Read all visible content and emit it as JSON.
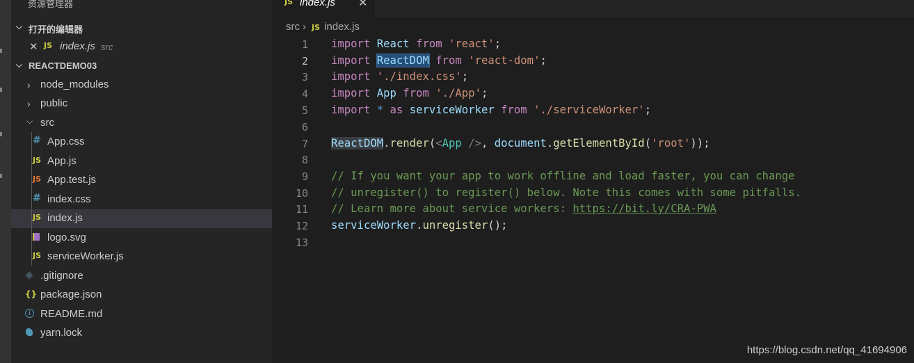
{
  "sidebar": {
    "title": "资源管理器",
    "open_editors": {
      "label": "打开的编辑器",
      "item": {
        "name": "index.js",
        "desc": "src"
      }
    },
    "project": {
      "label": "REACTDEMO03"
    },
    "tree": [
      {
        "name": "node_modules",
        "kind": "folder",
        "icon": ""
      },
      {
        "name": "public",
        "kind": "folder",
        "icon": ""
      },
      {
        "name": "src",
        "kind": "folder-open",
        "icon": ""
      },
      {
        "name": "App.css",
        "kind": "file",
        "icon": "#"
      },
      {
        "name": "App.js",
        "kind": "file",
        "icon": "JS"
      },
      {
        "name": "App.test.js",
        "kind": "file",
        "icon": "JS"
      },
      {
        "name": "index.css",
        "kind": "file",
        "icon": "#"
      },
      {
        "name": "index.js",
        "kind": "file",
        "icon": "JS"
      },
      {
        "name": "logo.svg",
        "kind": "file",
        "icon": "svg-icon"
      },
      {
        "name": "serviceWorker.js",
        "kind": "file",
        "icon": "JS"
      },
      {
        "name": ".gitignore",
        "kind": "file",
        "icon": "git-icon"
      },
      {
        "name": "package.json",
        "kind": "file",
        "icon": "{}"
      },
      {
        "name": "README.md",
        "kind": "file",
        "icon": "info-icon"
      },
      {
        "name": "yarn.lock",
        "kind": "file",
        "icon": "yarn-icon"
      }
    ]
  },
  "tab": {
    "name": "index.js",
    "icon": "JS"
  },
  "breadcrumb": {
    "folder": "src",
    "file": "index.js",
    "icon": "JS"
  },
  "editor": {
    "line_numbers": [
      "1",
      "2",
      "3",
      "4",
      "5",
      "6",
      "7",
      "8",
      "9",
      "10",
      "11",
      "12",
      "13"
    ],
    "active_line": "2",
    "tokens": {
      "import": "import",
      "from": "from",
      "as": "as",
      "React": "React",
      "ReactDOM": "ReactDOM",
      "App": "App",
      "star": "*",
      "serviceWorker": "serviceWorker",
      "s_react": "'react'",
      "s_reactdom": "'react-dom'",
      "s_indexcss": "'./index.css'",
      "s_app": "'./App'",
      "s_sw": "'./serviceWorker'",
      "s_root": "'root'",
      "render": "render",
      "document": "document",
      "getElementById": "getElementById",
      "unregister": "unregister",
      "semi": ";",
      "c1": "// If you want your app to work offline and load faster, you can change",
      "c2": "// unregister() to register() below. Note this comes with some pitfalls.",
      "c3": "// Learn more about service workers: ",
      "url": "https://bit.ly/CRA-PWA"
    }
  },
  "watermark": "https://blog.csdn.net/qq_41694906",
  "colors": {
    "js_icon": "#cbcb41",
    "css_icon": "#519aba",
    "test_icon": "#e37933",
    "svg_icon": "#a074c4",
    "json_icon": "#cbcb41",
    "info_icon": "#519aba",
    "git_icon": "#41535b",
    "yarn_icon": "#519aba"
  }
}
